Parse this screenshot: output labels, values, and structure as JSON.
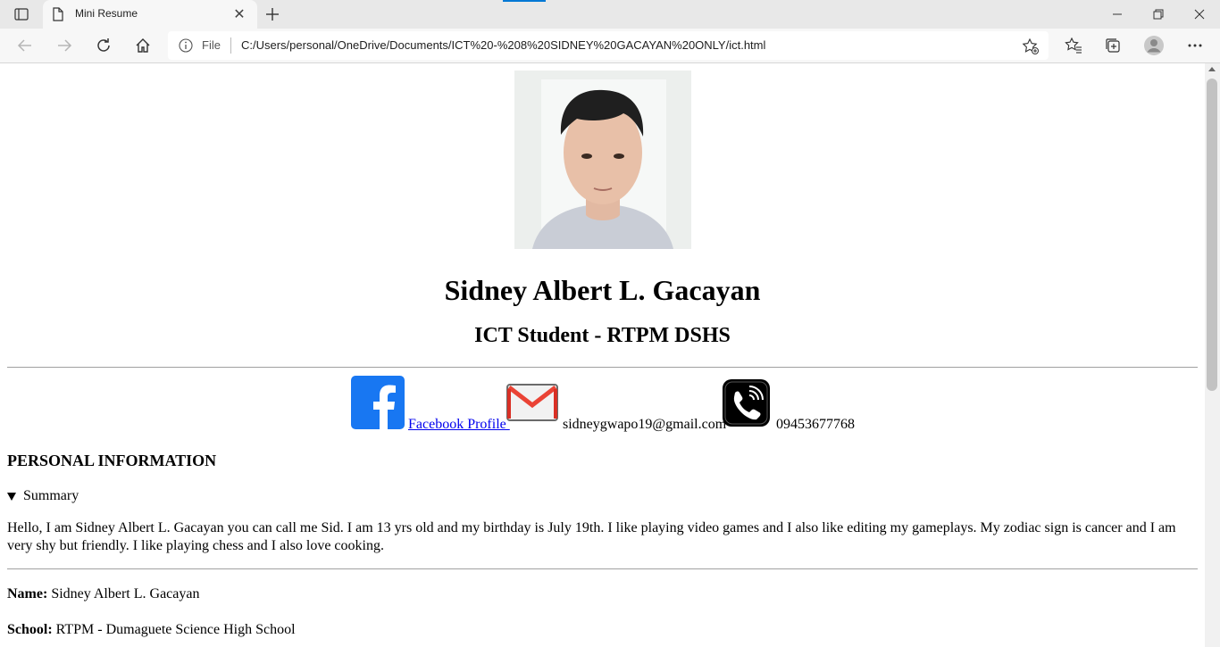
{
  "browser": {
    "tab_title": "Mini Resume",
    "tab_close": "✕",
    "address_file_label": "File",
    "address_url": "C:/Users/personal/OneDrive/Documents/ICT%20-%208%20SIDNEY%20GACAYAN%20ONLY/ict.html",
    "accent_color": "#0078d4"
  },
  "resume": {
    "name": "Sidney Albert L. Gacayan",
    "role": "ICT Student - RTPM DSHS",
    "contacts": {
      "facebook_label": "Facebook Profile ",
      "email": "sidneygwapo19@gmail.com",
      "phone": "09453677768"
    },
    "section_title": "PERSONAL INFORMATION",
    "summary_label": "Summary",
    "summary_text": "Hello, I am Sidney Albert L. Gacayan you can call me Sid. I am 13 yrs old and my birthday is July 19th. I like playing video games and I also like editing my gameplays. My zodiac sign is cancer and I am very shy but friendly. I like playing chess and I also love cooking.",
    "details": [
      {
        "label": "Name:",
        "value": " Sidney Albert L. Gacayan"
      },
      {
        "label": "School:",
        "value": " RTPM - Dumaguete Science High School"
      }
    ]
  },
  "icons": {
    "facebook": "facebook-icon",
    "email": "gmail-icon",
    "phone": "phone-icon"
  }
}
